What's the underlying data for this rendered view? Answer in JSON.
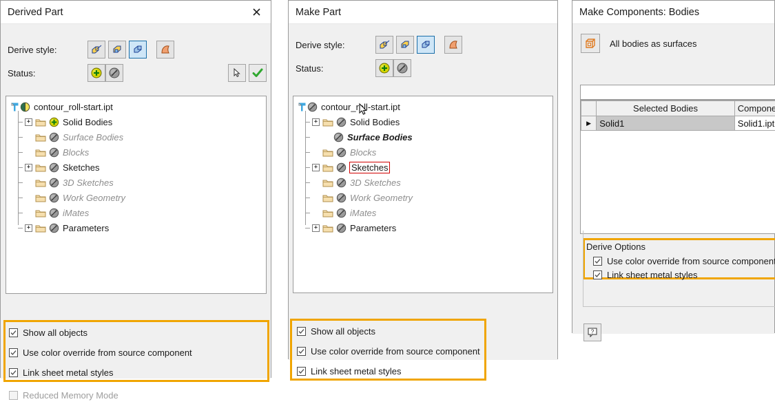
{
  "panel1": {
    "title": "Derived Part",
    "close_icon": "close-icon",
    "derive_style_label": "Derive style:",
    "status_label": "Status:",
    "derive_style_buttons": [
      {
        "name": "derive-style-solid-body",
        "selected": false
      },
      {
        "name": "derive-style-single-solid",
        "selected": false
      },
      {
        "name": "derive-style-body-as-work-surface",
        "selected": true
      },
      {
        "name": "derive-style-surface-only",
        "selected": false
      }
    ],
    "status_buttons": [
      {
        "name": "status-include-icon"
      },
      {
        "name": "status-exclude-icon"
      }
    ],
    "right_buttons": [
      {
        "name": "select-arrow-button"
      },
      {
        "name": "checkmark-button"
      }
    ],
    "tree": [
      {
        "label": "contour_roll-start.ipt",
        "style": "normal",
        "indent": 0,
        "expander": "",
        "icon": "part-icon",
        "folder": false
      },
      {
        "label": "Solid Bodies",
        "style": "normal",
        "indent": 1,
        "expander": "+",
        "icon": "include-icon",
        "folder": true
      },
      {
        "label": "Surface Bodies",
        "style": "dim",
        "indent": 1,
        "expander": "",
        "icon": "exclude-icon",
        "folder": true
      },
      {
        "label": "Blocks",
        "style": "dim",
        "indent": 1,
        "expander": "",
        "icon": "exclude-icon",
        "folder": true
      },
      {
        "label": "Sketches",
        "style": "normal",
        "indent": 1,
        "expander": "+",
        "icon": "exclude-icon",
        "folder": true
      },
      {
        "label": "3D Sketches",
        "style": "dim",
        "indent": 1,
        "expander": "",
        "icon": "exclude-icon",
        "folder": true
      },
      {
        "label": "Work Geometry",
        "style": "dim",
        "indent": 1,
        "expander": "",
        "icon": "exclude-icon",
        "folder": true
      },
      {
        "label": "iMates",
        "style": "dim",
        "indent": 1,
        "expander": "",
        "icon": "exclude-icon",
        "folder": true
      },
      {
        "label": "Parameters",
        "style": "normal",
        "indent": 1,
        "expander": "+",
        "icon": "exclude-icon",
        "folder": true
      }
    ],
    "checkboxes": [
      {
        "label": "Show all objects",
        "checked": true,
        "enabled": true
      },
      {
        "label": "Use color override from source component",
        "checked": true,
        "enabled": true
      },
      {
        "label": "Link sheet metal styles",
        "checked": true,
        "enabled": true
      }
    ],
    "checkbox_outside": {
      "label": "Reduced Memory Mode",
      "checked": false,
      "enabled": false
    }
  },
  "panel2": {
    "title": "Make Part",
    "derive_style_label": "Derive style:",
    "status_label": "Status:",
    "derive_style_buttons": [
      {
        "name": "derive-style-solid-body",
        "selected": false
      },
      {
        "name": "derive-style-single-solid",
        "selected": false
      },
      {
        "name": "derive-style-body-as-work-surface",
        "selected": true
      },
      {
        "name": "derive-style-surface-only",
        "selected": false
      }
    ],
    "status_buttons": [
      {
        "name": "status-include-icon"
      },
      {
        "name": "status-exclude-icon"
      }
    ],
    "tree": [
      {
        "label": "contour_roll-start.ipt",
        "style": "normal",
        "indent": 0,
        "expander": "",
        "icon": "exclude-icon",
        "folder": false
      },
      {
        "label": "Solid Bodies",
        "style": "normal",
        "indent": 1,
        "expander": "+",
        "icon": "exclude-icon",
        "folder": true
      },
      {
        "label": "Surface Bodies",
        "style": "ital",
        "indent": 2,
        "expander": "",
        "icon": "exclude-icon",
        "folder": false
      },
      {
        "label": "Blocks",
        "style": "dim",
        "indent": 1,
        "expander": "",
        "icon": "exclude-icon",
        "folder": true
      },
      {
        "label": "Sketches",
        "style": "normal",
        "indent": 1,
        "expander": "+",
        "icon": "exclude-icon",
        "folder": true,
        "highlight": true
      },
      {
        "label": "3D Sketches",
        "style": "dim",
        "indent": 1,
        "expander": "",
        "icon": "exclude-icon",
        "folder": true
      },
      {
        "label": "Work Geometry",
        "style": "dim",
        "indent": 1,
        "expander": "",
        "icon": "exclude-icon",
        "folder": true
      },
      {
        "label": "iMates",
        "style": "dim",
        "indent": 1,
        "expander": "",
        "icon": "exclude-icon",
        "folder": true
      },
      {
        "label": "Parameters",
        "style": "normal",
        "indent": 1,
        "expander": "+",
        "icon": "exclude-icon",
        "folder": true
      }
    ],
    "checkboxes": [
      {
        "label": "Show all objects",
        "checked": true,
        "enabled": true
      },
      {
        "label": "Use color override from source component",
        "checked": true,
        "enabled": true
      },
      {
        "label": "Link sheet metal styles",
        "checked": true,
        "enabled": true
      }
    ]
  },
  "panel3": {
    "title": "Make Components: Bodies",
    "surfaces_button": {
      "name": "all-bodies-as-surfaces-button",
      "label": "All bodies as surfaces"
    },
    "table": {
      "columns": [
        "",
        "Selected Bodies",
        "Component"
      ],
      "rows": [
        {
          "marker": "▶",
          "selected_body": "Solid1",
          "component": "Solid1.ipt"
        }
      ]
    },
    "derive_options": {
      "title": "Derive Options",
      "checkboxes": [
        {
          "label": "Use color override from source component",
          "checked": true
        },
        {
          "label": "Link sheet metal styles",
          "checked": true
        }
      ]
    },
    "help_button": {
      "name": "help-button",
      "label": "?"
    }
  },
  "colors": {
    "highlight_orange": "#f0a500",
    "highlight_red": "#d00000",
    "selection_blue": "#1a6ea8",
    "panel_bg": "#f0f0f0",
    "folder_yellow": "#f2d49b"
  }
}
